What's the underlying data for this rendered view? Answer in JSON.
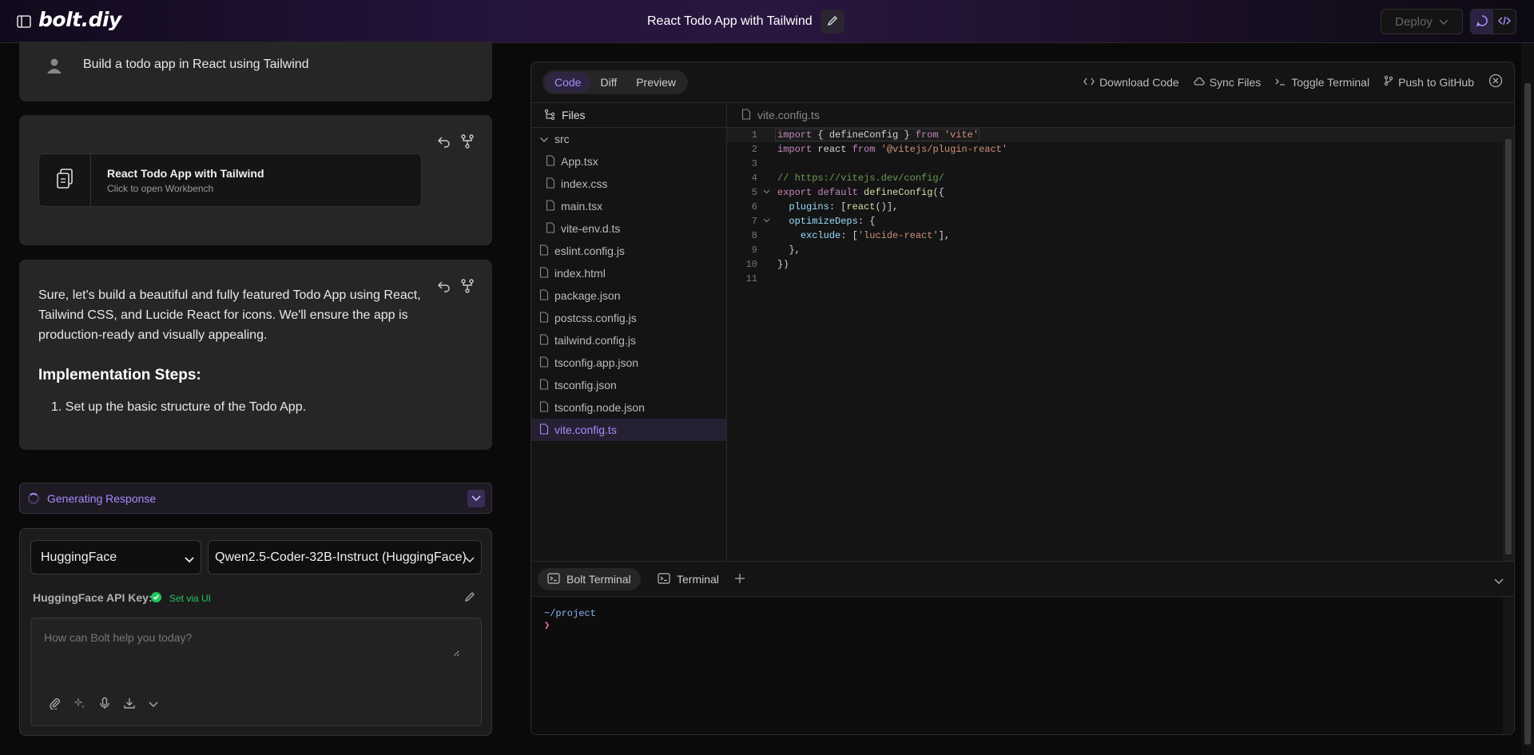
{
  "header": {
    "logo_main": "bolt",
    "logo_dot": ".",
    "logo_suffix": "diy",
    "project_title": "React Todo App with Tailwind",
    "deploy_label": "Deploy"
  },
  "chat": {
    "user_message": "Build a todo app in React using Tailwind",
    "artifact": {
      "title": "React Todo App with Tailwind",
      "subtitle": "Click to open Workbench"
    },
    "assistant": {
      "paragraph": "Sure, let's build a beautiful and fully featured Todo App using React, Tailwind CSS, and Lucide React for icons. We'll ensure the app is production-ready and visually appealing.",
      "heading": "Implementation Steps:",
      "steps": [
        "Set up the basic structure of the Todo App."
      ]
    },
    "generating_label": "Generating Response"
  },
  "input": {
    "provider": "HuggingFace",
    "model": "Qwen2.5-Coder-32B-Instruct (HuggingFace)",
    "api_key_label": "HuggingFace API Key:",
    "api_key_status": "Set via UI",
    "placeholder": "How can Bolt help you today?"
  },
  "workbench": {
    "tabs": [
      "Code",
      "Diff",
      "Preview"
    ],
    "active_tab": "Code",
    "actions": {
      "download": "Download Code",
      "sync": "Sync Files",
      "toggle_terminal": "Toggle Terminal",
      "push": "Push to GitHub"
    },
    "files_label": "Files",
    "open_file": "vite.config.ts",
    "files": [
      {
        "name": "src",
        "type": "folder",
        "depth": 0
      },
      {
        "name": "App.tsx",
        "type": "file",
        "depth": 1
      },
      {
        "name": "index.css",
        "type": "file",
        "depth": 1
      },
      {
        "name": "main.tsx",
        "type": "file",
        "depth": 1
      },
      {
        "name": "vite-env.d.ts",
        "type": "file",
        "depth": 1
      },
      {
        "name": "eslint.config.js",
        "type": "file",
        "depth": 0
      },
      {
        "name": "index.html",
        "type": "file",
        "depth": 0
      },
      {
        "name": "package.json",
        "type": "file",
        "depth": 0
      },
      {
        "name": "postcss.config.js",
        "type": "file",
        "depth": 0
      },
      {
        "name": "tailwind.config.js",
        "type": "file",
        "depth": 0
      },
      {
        "name": "tsconfig.app.json",
        "type": "file",
        "depth": 0
      },
      {
        "name": "tsconfig.json",
        "type": "file",
        "depth": 0
      },
      {
        "name": "tsconfig.node.json",
        "type": "file",
        "depth": 0
      },
      {
        "name": "vite.config.ts",
        "type": "file",
        "depth": 0,
        "selected": true
      }
    ],
    "code_lines": [
      {
        "n": "1",
        "text": "import { defineConfig } from 'vite'",
        "fold": ""
      },
      {
        "n": "2",
        "text": "import react from '@vitejs/plugin-react'",
        "fold": ""
      },
      {
        "n": "3",
        "text": "",
        "fold": ""
      },
      {
        "n": "4",
        "text": "// https://vitejs.dev/config/",
        "fold": ""
      },
      {
        "n": "5",
        "text": "export default defineConfig({",
        "fold": "v"
      },
      {
        "n": "6",
        "text": "  plugins: [react()],",
        "fold": ""
      },
      {
        "n": "7",
        "text": "  optimizeDeps: {",
        "fold": "v"
      },
      {
        "n": "8",
        "text": "    exclude: ['lucide-react'],",
        "fold": ""
      },
      {
        "n": "9",
        "text": "  },",
        "fold": ""
      },
      {
        "n": "10",
        "text": "})",
        "fold": ""
      },
      {
        "n": "11",
        "text": "",
        "fold": ""
      }
    ],
    "terminal": {
      "tabs": [
        "Bolt Terminal",
        "Terminal"
      ],
      "path": "~/project",
      "prompt": "❯"
    }
  }
}
